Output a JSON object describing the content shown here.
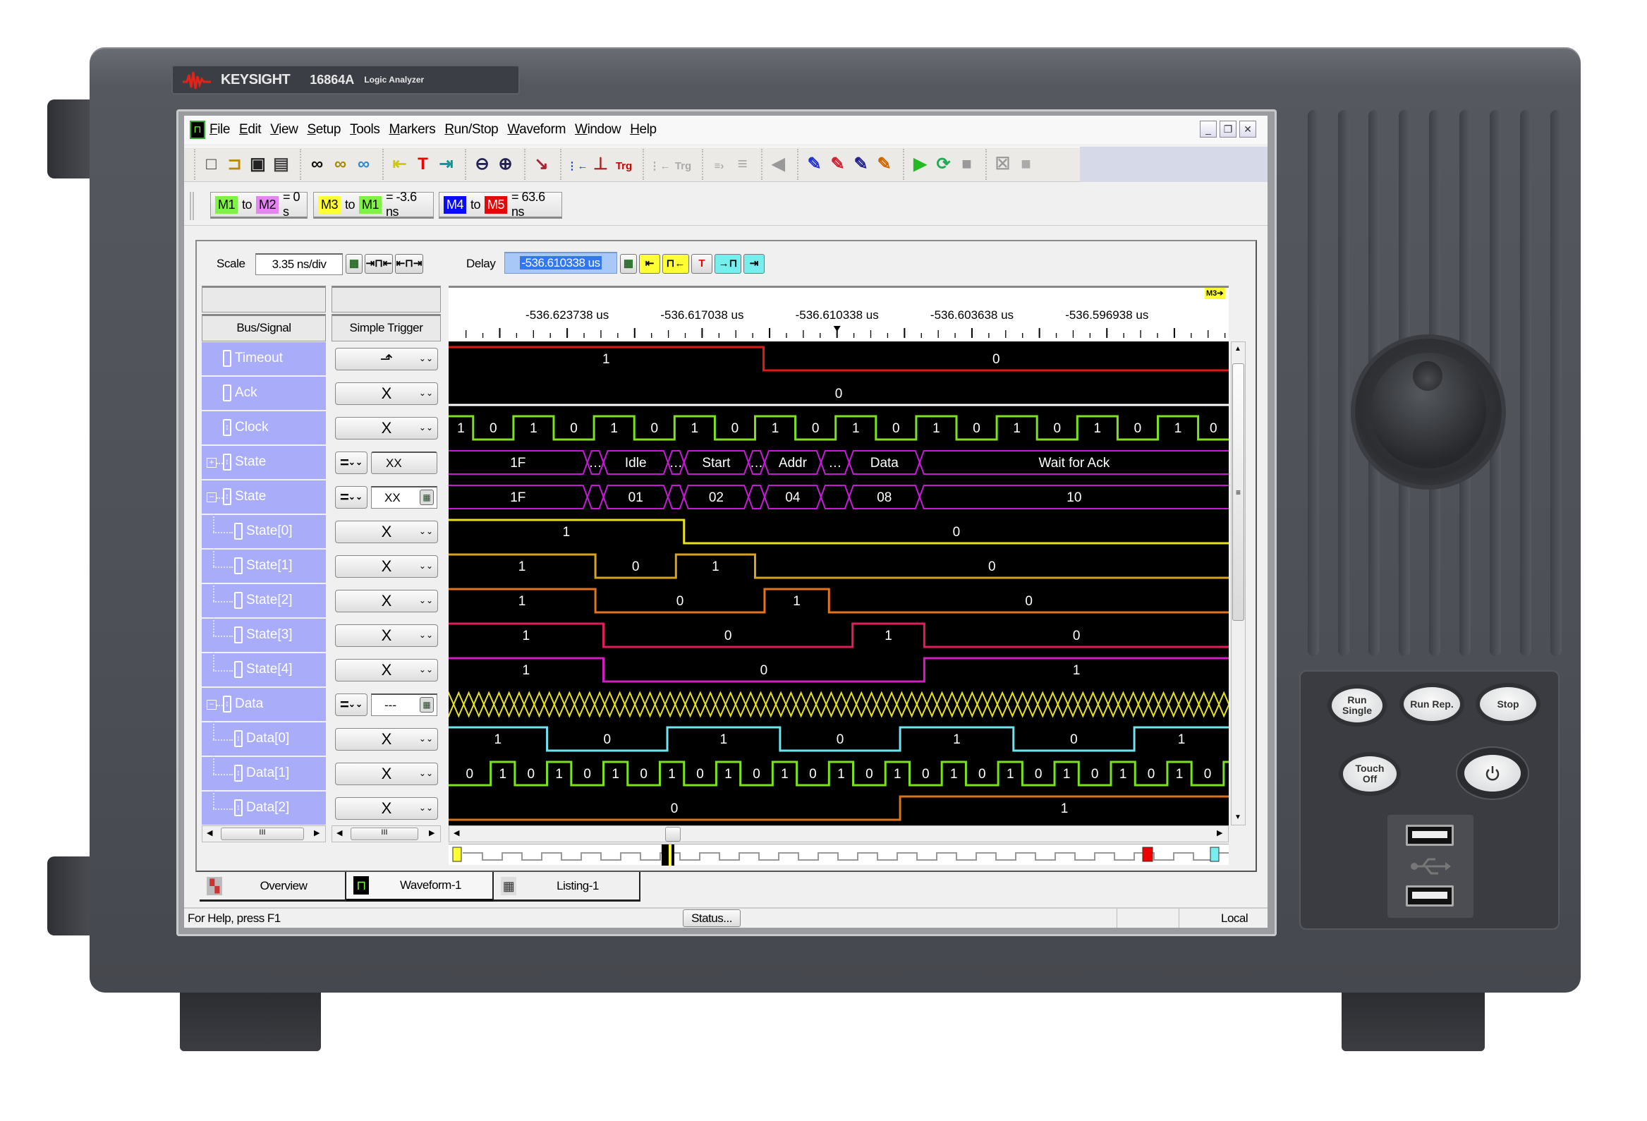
{
  "device": {
    "brand": "KEYSIGHT",
    "model": "16864A",
    "type": "Logic Analyzer"
  },
  "menu": [
    "File",
    "Edit",
    "View",
    "Setup",
    "Tools",
    "Markers",
    "Run/Stop",
    "Waveform",
    "Window",
    "Help"
  ],
  "window_controls": [
    "minimize-icon",
    "restore-icon",
    "close-icon"
  ],
  "toolbar": {
    "groups": [
      [
        "new-file-icon",
        "open-folder-icon",
        "save-icon",
        "print-icon"
      ],
      [
        "find-icon",
        "find-previous-icon",
        "find-next-icon"
      ],
      [
        "go-to-start-icon",
        "go-to-trigger-icon",
        "go-to-end-icon"
      ],
      [
        "zoom-out-icon",
        "zoom-in-icon"
      ],
      [
        "overview-icon"
      ],
      [
        "insert-signal-icon",
        "trigger-edge-icon",
        "trigger-icon"
      ],
      [
        "insert-signal-disabled-icon",
        "trigger-disabled-icon"
      ],
      [
        "align-disabled-icon",
        "distribute-disabled-icon"
      ],
      [
        "speaker-disabled-icon"
      ],
      [
        "place-marker-icon",
        "marker-to-trigger-icon",
        "marker-interval-icon",
        "marker-offset-icon"
      ],
      [
        "run-icon",
        "run-repetitive-icon",
        "stop-icon"
      ],
      [
        "clear-icon",
        "square-icon"
      ]
    ]
  },
  "marker_measurements": [
    {
      "a": "M1",
      "a_color": "#7ff244",
      "connector": "to",
      "b": "M2",
      "b_color": "#e585f2",
      "result": "= 0 s"
    },
    {
      "a": "M3",
      "a_color": "#ffff33",
      "connector": "to",
      "b": "M1",
      "b_color": "#7ff244",
      "result": "= -3.6 ns"
    },
    {
      "a": "M4",
      "a_color": "#0a0aff",
      "connector": "to",
      "b": "M5",
      "b_color": "#e00a0a",
      "result": "= 63.6 ns"
    }
  ],
  "scale": {
    "label": "Scale",
    "value": "3.35 ns/div"
  },
  "delay": {
    "label": "Delay",
    "value": "-536.610338 us"
  },
  "columns": {
    "signal": "Bus/Signal",
    "trigger": "Simple Trigger"
  },
  "time_axis": {
    "tick_labels": [
      "-536.623738 us",
      "-536.617038 us",
      "-536.610338 us",
      "-536.603638 us",
      "-536.596938 us"
    ],
    "marker_tag": "M3",
    "marker_tag_color": "#ffff33"
  },
  "signals": [
    {
      "name": "Timeout",
      "level": 0,
      "expander": "",
      "icon": "single-bit-icon",
      "trigger": {
        "kind": "edge",
        "value": "rising-falling-edge",
        "glyph": "⬏"
      },
      "wave": {
        "type": "digital",
        "color": "#e01818",
        "initial": 1,
        "edges_us": [
          -536.613988
        ]
      }
    },
    {
      "name": "Ack",
      "level": 0,
      "expander": "",
      "icon": "single-bit-icon",
      "trigger": {
        "kind": "select",
        "value": "X"
      },
      "wave": {
        "type": "digital",
        "color": "#ffffff",
        "initial": 0,
        "edges_us": []
      }
    },
    {
      "name": "Clock",
      "level": 0,
      "expander": "",
      "icon": "clock-signal-icon",
      "trigger": {
        "kind": "select",
        "value": "X"
      },
      "wave": {
        "type": "periodic",
        "color": "#7ee11e",
        "initial": 1,
        "first_edge_us": -536.628408,
        "high_us": 0.002,
        "low_us": 0.002
      }
    },
    {
      "name": "State",
      "level": 0,
      "expander": "+",
      "icon": "bus-icon",
      "trigger": {
        "kind": "compare",
        "op": "=",
        "value": "XX",
        "calc": false
      },
      "wave": {
        "type": "bus",
        "color": "#c61ad6",
        "segments": [
          {
            "start_us": null,
            "label": "1F"
          },
          {
            "start_us": -536.622738,
            "label": "…"
          },
          {
            "start_us": -536.621938,
            "label": "Idle"
          },
          {
            "start_us": -536.618738,
            "label": "…"
          },
          {
            "start_us": -536.617938,
            "label": "Start"
          },
          {
            "start_us": -536.614738,
            "label": "…"
          },
          {
            "start_us": -536.613938,
            "label": "Addr"
          },
          {
            "start_us": -536.611138,
            "label": "…"
          },
          {
            "start_us": -536.609738,
            "label": "Data"
          },
          {
            "start_us": -536.606238,
            "label": "Wait for Ack"
          }
        ]
      }
    },
    {
      "name": "State",
      "level": 0,
      "expander": "-",
      "icon": "bus-icon",
      "trigger": {
        "kind": "compare",
        "op": "=",
        "value": "XX",
        "calc": true
      },
      "wave": {
        "type": "bus",
        "color": "#c61ad6",
        "segments": [
          {
            "start_us": null,
            "label": "1F"
          },
          {
            "start_us": -536.622738,
            "label": ""
          },
          {
            "start_us": -536.621938,
            "label": "01"
          },
          {
            "start_us": -536.618738,
            "label": ""
          },
          {
            "start_us": -536.617938,
            "label": "02"
          },
          {
            "start_us": -536.614738,
            "label": ""
          },
          {
            "start_us": -536.613938,
            "label": "04"
          },
          {
            "start_us": -536.611138,
            "label": ""
          },
          {
            "start_us": -536.609738,
            "label": "08"
          },
          {
            "start_us": -536.606238,
            "label": "10"
          }
        ]
      }
    },
    {
      "name": "State[0]",
      "level": 1,
      "expander": "",
      "icon": "single-bit-icon",
      "trigger": {
        "kind": "select",
        "value": "X"
      },
      "wave": {
        "type": "digital",
        "color": "#e6e21e",
        "initial": 1,
        "edges_us": [
          -536.617938
        ]
      }
    },
    {
      "name": "State[1]",
      "level": 1,
      "expander": "",
      "icon": "single-bit-icon",
      "trigger": {
        "kind": "select",
        "value": "X"
      },
      "wave": {
        "type": "digital",
        "color": "#d9a320",
        "initial": 1,
        "edges_us": [
          -536.622338,
          -536.618338,
          -536.614408
        ]
      }
    },
    {
      "name": "State[2]",
      "level": 1,
      "expander": "",
      "icon": "single-bit-icon",
      "trigger": {
        "kind": "select",
        "value": "X"
      },
      "wave": {
        "type": "digital",
        "color": "#e2741e",
        "initial": 1,
        "edges_us": [
          -536.622338,
          -536.613938,
          -536.610738
        ]
      }
    },
    {
      "name": "State[3]",
      "level": 1,
      "expander": "",
      "icon": "single-bit-icon",
      "trigger": {
        "kind": "select",
        "value": "X"
      },
      "wave": {
        "type": "digital",
        "color": "#e01e5a",
        "initial": 1,
        "edges_us": [
          -536.621938,
          -536.609568,
          -536.606008
        ]
      }
    },
    {
      "name": "State[4]",
      "level": 1,
      "expander": "",
      "icon": "single-bit-icon",
      "trigger": {
        "kind": "select",
        "value": "X"
      },
      "wave": {
        "type": "digital",
        "color": "#d21ec4",
        "initial": 1,
        "edges_us": [
          -536.621938,
          -536.606008
        ]
      }
    },
    {
      "name": "Data",
      "level": 0,
      "expander": "-",
      "icon": "bus-clock-icon",
      "trigger": {
        "kind": "compare",
        "op": "=",
        "value": "---",
        "calc": true
      },
      "wave": {
        "type": "bus_random",
        "color": "#e6e21e",
        "transition_interval_us": 0.0005
      }
    },
    {
      "name": "Data[0]",
      "level": 1,
      "expander": "",
      "icon": "clock-signal-icon",
      "trigger": {
        "kind": "select",
        "value": "X"
      },
      "wave": {
        "type": "digital",
        "color": "#6ee4f0",
        "initial": 1,
        "edges_us": [
          -536.624738,
          -536.618768,
          -536.613168,
          -536.607208,
          -536.601578,
          -536.595578
        ]
      }
    },
    {
      "name": "Data[1]",
      "level": 1,
      "expander": "",
      "icon": "clock-signal-icon",
      "trigger": {
        "kind": "select",
        "value": "X"
      },
      "wave": {
        "type": "periodic",
        "color": "#7ee11e",
        "initial": 0,
        "first_edge_us": -536.627538,
        "high_us": 0.0012,
        "low_us": 0.0016
      }
    },
    {
      "name": "Data[2]",
      "level": 1,
      "expander": "",
      "icon": "clock-signal-icon",
      "trigger": {
        "kind": "select",
        "value": "X"
      },
      "wave": {
        "type": "digital",
        "color": "#d8741e",
        "initial": 0,
        "edges_us": [
          -536.607208
        ]
      }
    }
  ],
  "tabs": [
    {
      "label": "Overview",
      "icon": "overview-tab-icon",
      "active": false
    },
    {
      "label": "Waveform-1",
      "icon": "waveform-tab-icon",
      "active": true
    },
    {
      "label": "Listing-1",
      "icon": "listing-tab-icon",
      "active": false
    }
  ],
  "status": {
    "help": "For Help, press F1",
    "status_button": "Status...",
    "mode": "Local"
  },
  "front_panel": {
    "run_single": "Run Single",
    "run_repetitive": "Run Rep.",
    "stop": "Stop",
    "touch_off": "Touch Off",
    "power_icon": "power-icon",
    "usb_icon": "usb-icon"
  }
}
